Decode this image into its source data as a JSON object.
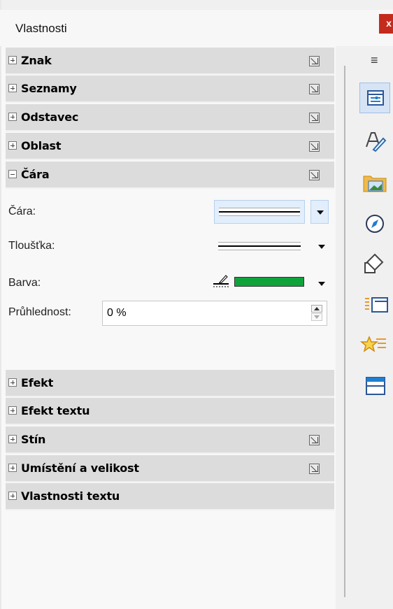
{
  "window": {
    "title": "Vlastnosti",
    "close_label": "x"
  },
  "sections_top": [
    {
      "label": "Znak",
      "has_more": true
    },
    {
      "label": "Seznamy",
      "has_more": true
    },
    {
      "label": "Odstavec",
      "has_more": true
    },
    {
      "label": "Oblast",
      "has_more": true
    },
    {
      "label": "Čára",
      "has_more": true,
      "expanded": true
    }
  ],
  "line_panel": {
    "line_label": "Čára:",
    "width_label": "Tloušťka:",
    "color_label": "Barva:",
    "transparency_label": "Průhlednost:",
    "transparency_value": "0 %",
    "color_value": "#10a33c"
  },
  "sections_bottom": [
    {
      "label": "Efekt",
      "has_more": false
    },
    {
      "label": "Efekt textu",
      "has_more": false
    },
    {
      "label": "Stín",
      "has_more": true
    },
    {
      "label": "Umístění a velikost",
      "has_more": true
    },
    {
      "label": "Vlastnosti textu",
      "has_more": false
    }
  ],
  "deck": {
    "menu_icon": "hamburger-icon",
    "buttons": [
      {
        "icon": "properties-icon",
        "active": true
      },
      {
        "icon": "styles-icon",
        "active": false
      },
      {
        "icon": "gallery-icon",
        "active": false
      },
      {
        "icon": "navigator-icon",
        "active": false
      },
      {
        "icon": "shapes-icon",
        "active": false
      },
      {
        "icon": "page-icon",
        "active": false
      },
      {
        "icon": "style-inspector-icon",
        "active": false
      },
      {
        "icon": "manage-changes-icon",
        "active": false
      }
    ]
  }
}
